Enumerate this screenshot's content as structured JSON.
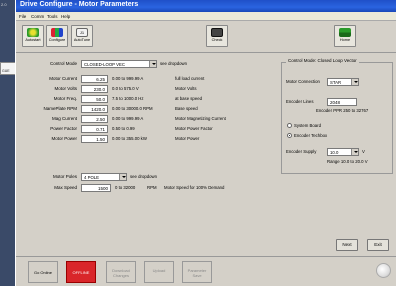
{
  "background_app": {
    "number": "2.0",
    "label": "GUE"
  },
  "window": {
    "title": "Drive Configure - Motor Parameters"
  },
  "menu": [
    "File",
    "Comm",
    "Tools",
    "Help"
  ],
  "toolbar": [
    {
      "label": "Autostart",
      "icon": "autostart-icon"
    },
    {
      "label": "Configure",
      "icon": "configure-icon"
    },
    {
      "label": "AutoTune",
      "icon": "autotune-icon"
    },
    {
      "label": "Check",
      "icon": "check-icon"
    },
    {
      "label": "Home",
      "icon": "home-icon"
    }
  ],
  "control_mode": {
    "label": "Control Mode",
    "value": "CLOSED-LOOP VEC",
    "note": "see dropdown"
  },
  "params": [
    {
      "label": "Motor Current",
      "value": "6.25",
      "range": "0.00 to 999.99 A",
      "desc": "full load current"
    },
    {
      "label": "Motor Volts",
      "value": "230.0",
      "range": "0.0 to 575.0 V",
      "desc": "Motor Volts"
    },
    {
      "label": "Motor Freq.",
      "value": "50.0",
      "range": "7.5 to 1000.0 Hz",
      "desc": "at base speed"
    },
    {
      "label": "NamePlate RPM",
      "value": "1420.0",
      "range": "0.00 to 30000.0 RPM",
      "desc": "Base speed"
    },
    {
      "label": "Mag Current",
      "value": "2.50",
      "range": "0.00 to 999.99 A",
      "desc": "Motor Magnetizing Current"
    },
    {
      "label": "Power Factor",
      "value": "0.71",
      "range": "0.50 to 0.99",
      "desc": "Motor Power Factor"
    },
    {
      "label": "Motor Power",
      "value": "1.50",
      "range": "0.00 to 355.00 kW",
      "desc": "Motor Power"
    }
  ],
  "motor_poles": {
    "label": "Motor Poles",
    "value": "4 POLE",
    "note": "see dropdown"
  },
  "max_speed": {
    "label": "Max Speed",
    "value": "1500",
    "range": "0 to 32000",
    "unit": "RPM",
    "desc": "Motor Speed for 100% Demand"
  },
  "right_panel": {
    "title": "Control Mode:  Closed Loop Vector",
    "connection_label": "Motor Connection",
    "connection_value": "STAR",
    "encoder_lines_label": "Encoder Lines",
    "encoder_lines_value": "2048",
    "encoder_ppr": "Encoder PPR  250 to 32767",
    "radio_system": "System Board",
    "radio_techbox": "Encoder Techbox",
    "supply_label": "Encoder Supply",
    "supply_value": "10.0",
    "supply_unit": "V",
    "supply_range": "Range    10.0 to 20.0 V"
  },
  "nav": {
    "next": "Next",
    "exit": "Exit"
  },
  "bottom": {
    "go_online": "Go Online",
    "offline": "OFFLINE",
    "download": "Download Changes",
    "upload": "Upload",
    "save": "Parameter Save"
  },
  "colors": {
    "title_bar": "#2a64e0",
    "offline": "#d9262a",
    "window": "#d4d0c8"
  }
}
